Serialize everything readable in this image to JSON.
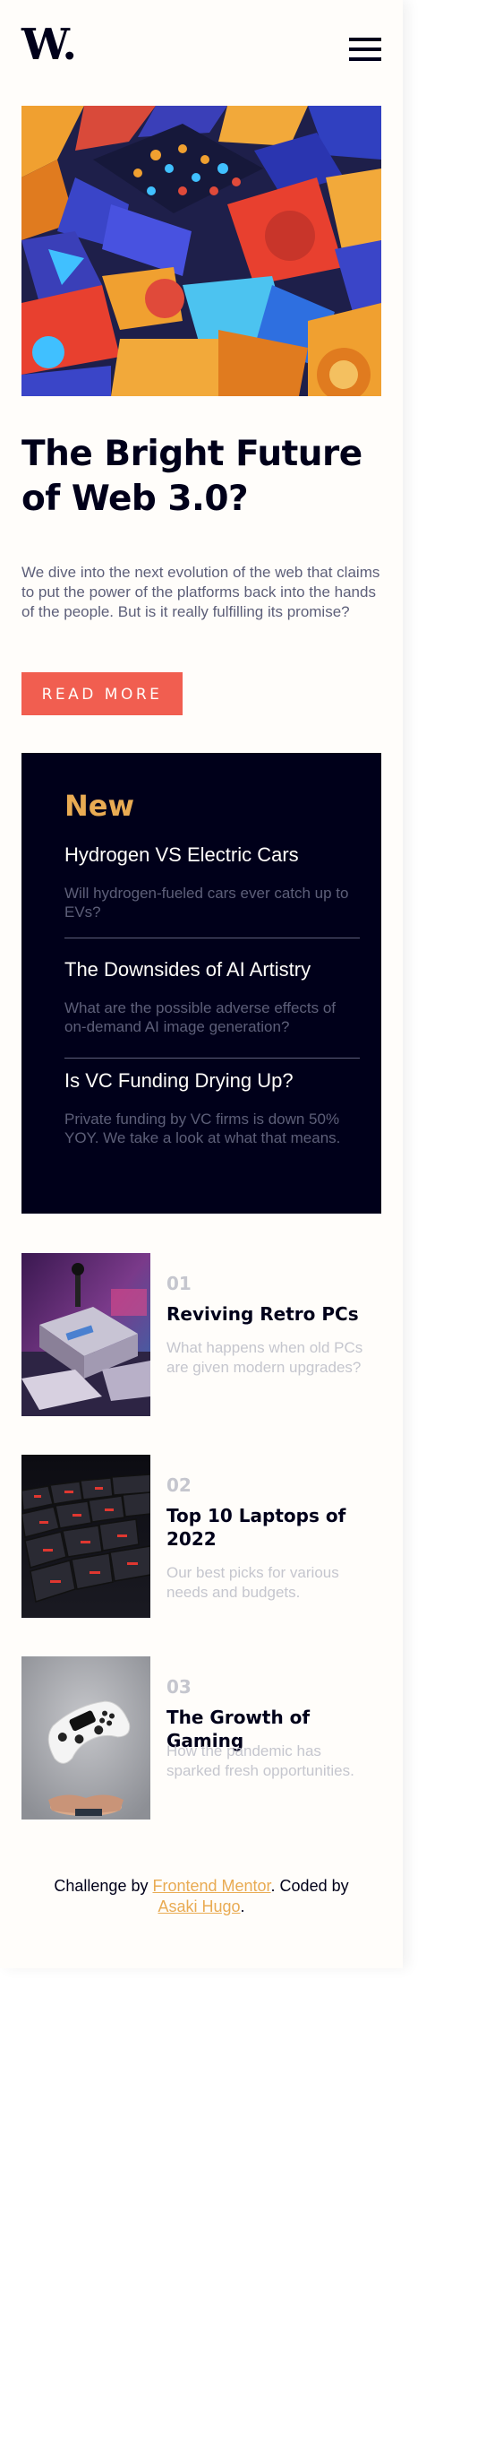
{
  "header": {
    "logo": "W.",
    "menu_icon": "hamburger-menu-icon"
  },
  "hero": {
    "image_icon": "abstract-3d-blocks-image",
    "title": "The Bright Future of Web 3.0?",
    "description": "We dive into the next evolution of the web that claims to put the power of the platforms back into the hands of the people. But is it really fulfilling its promise?",
    "button_label": "READ MORE"
  },
  "new": {
    "title": "New",
    "items": [
      {
        "title": "Hydrogen VS Electric Cars",
        "description": "Will hydrogen-fueled cars ever catch up to EVs?"
      },
      {
        "title": "The Downsides of AI Artistry",
        "description": "What are the possible adverse effects of on-demand AI image generation?"
      },
      {
        "title": "Is VC Funding Drying Up?",
        "description": "Private funding by VC firms is down 50% YOY. We take a look at what that means."
      }
    ]
  },
  "articles": [
    {
      "number": "01",
      "title": "Reviving Retro PCs",
      "description": "What happens when old PCs are given modern upgrades?",
      "image": "retro-pc-image"
    },
    {
      "number": "02",
      "title": "Top 10 Laptops of 2022",
      "description": "Our best picks for various needs and budgets.",
      "image": "laptop-keyboard-image"
    },
    {
      "number": "03",
      "title": "The Growth of Gaming",
      "description": "How the pandemic has sparked fresh opportunities.",
      "image": "game-controller-image"
    }
  ],
  "footer": {
    "text_before": "Challenge by ",
    "link1": "Frontend Mentor",
    "text_middle": ". Coded by ",
    "link2": "Asaki Hugo",
    "text_after": "."
  },
  "colors": {
    "accent_red": "#f15e50",
    "accent_orange": "#e9ab53",
    "dark_navy": "#00001a",
    "grayish_blue": "#5d5f79",
    "off_white": "#fffdfa"
  }
}
